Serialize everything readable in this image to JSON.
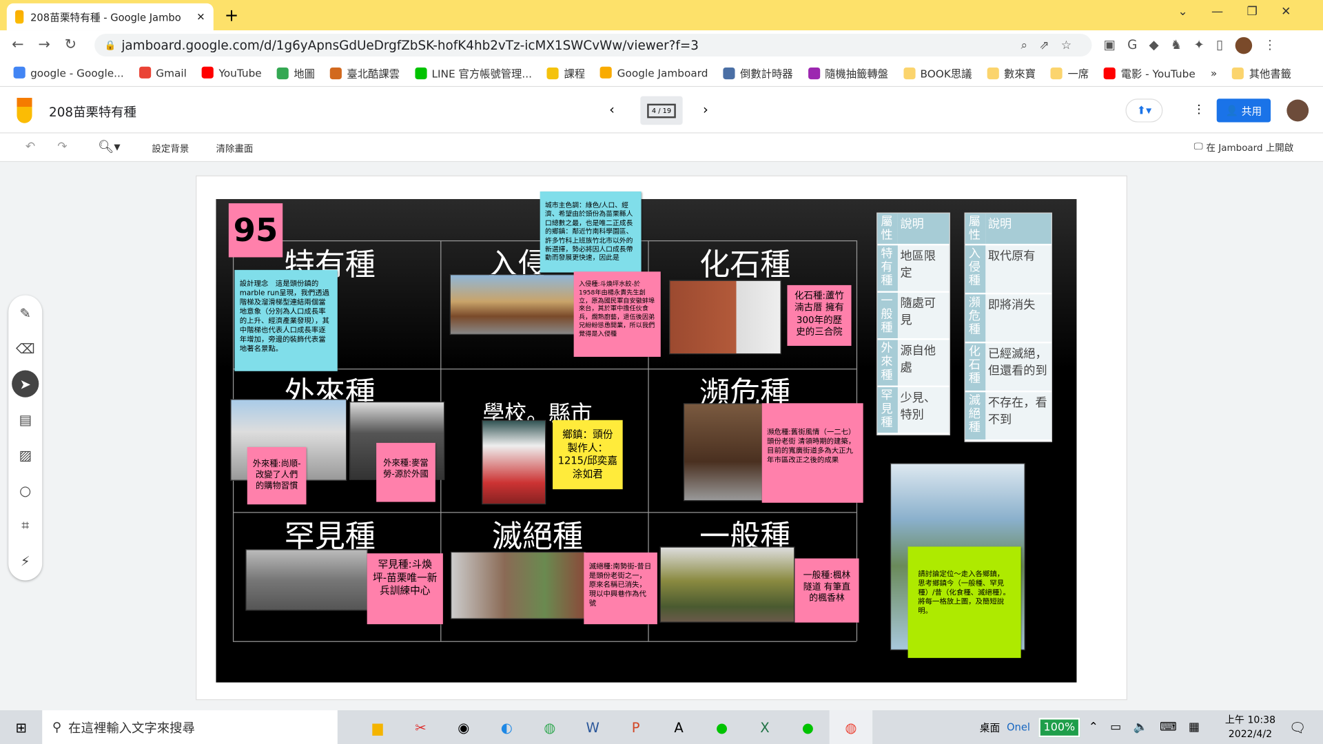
{
  "browser": {
    "tab_title": "208苗栗特有種 - Google Jambo",
    "url": "jamboard.google.com/d/1g6yApnsGdUeDrgfZbSK-hofK4hb2vTz-icMX1SWCvWw/viewer?f=3",
    "bookmarks": [
      {
        "label": "google - Google...",
        "color": "#4285f4"
      },
      {
        "label": "Gmail",
        "color": "#ea4335"
      },
      {
        "label": "YouTube",
        "color": "#ff0000"
      },
      {
        "label": "地圖",
        "color": "#34a853"
      },
      {
        "label": "臺北酷課雲",
        "color": "#d2691e"
      },
      {
        "label": "LINE 官方帳號管理...",
        "color": "#00c300"
      },
      {
        "label": "課程",
        "color": "#f4c20d"
      },
      {
        "label": "Google Jamboard",
        "color": "#f9ab00"
      },
      {
        "label": "倒數計時器",
        "color": "#4a6fa5"
      },
      {
        "label": "隨機抽籤轉盤",
        "color": "#9c27b0"
      },
      {
        "label": "BOOK思議",
        "color": "#fbd46d"
      },
      {
        "label": "數來寶",
        "color": "#fbd46d"
      },
      {
        "label": "一席",
        "color": "#fbd46d"
      },
      {
        "label": "電影 - YouTube",
        "color": "#ff0000"
      }
    ],
    "bookmarks_more": "»",
    "other_bookmarks": "其他書籤"
  },
  "jamboard": {
    "title": "208苗栗特有種",
    "page_indicator": "4 / 19",
    "share_label": "共用",
    "bg_label": "設定背景",
    "clear_label": "清除畫面",
    "open_label": "在 Jamboard 上開啟"
  },
  "slide": {
    "number": "95",
    "categories": {
      "endemic": "特有種",
      "invasive": "入侵",
      "fossil": "化石種",
      "alien": "外來種",
      "school": "學校。縣市",
      "endangered": "瀕危種",
      "rare": "罕見種",
      "extinct": "滅絕種",
      "common": "一般種"
    },
    "notes": {
      "design": "設計理念　這是頭份鎮的marble run呈現，我們透過階梯及溜滑梯型連結兩個當地意象（分別為人口成長率的上升、經濟產業發現），其中階梯也代表人口成長率逐年增加，旁邊的裝飾代表當地著名景點。",
      "city": "城市主色調：綠色/人口、經濟、希望由於頭份為苗栗縣人口總數之最，也是唯二正成長的鄉鎮：鄰近竹南科學園區、許多竹科上班族竹北市以外的新選擇，勢必將因人口成長帶動而發展更快速，因此是",
      "invasive": "入侵種:斗煥坪水餃-於1958年由楊永貴先生創立，原為國民軍自安徽蚌埠來台，其於軍中擔任伙食兵，燗熟廚藝，退伍後因弟兄紛紛慫恿開業，所以我們覺得是入侵種",
      "fossil": "化石種:蘆竹湳古厝 擁有300年的歷史的三合院",
      "alien1": "外來種:尚順-改變了人們的購物習慣",
      "alien2": "外來種:麥當勞-源於外國",
      "town": "鄉鎮：頭份製作人：1215/邱奕嘉涂如君",
      "endangered": "瀕危種:舊街風情（一二七）頭份老街 清領時期的建築，目前的寬廣街道多為大正九年市區改正之後的成果",
      "rare": "罕見種:斗煥坪-苗栗唯一新兵訓練中心",
      "extinct": "滅絕種:南勢街-昔日是頭份老街之一，原來名稱已消失，現以中興巷作為代號",
      "common": "一般種:楓林隧道 有筆直的楓香林",
      "instruction": "請討論定位～走入各鄉鎮，思考鄉鎮今（一般種、罕見種）/昔（化食種、滅絕種）。將每一格放上圖，及簡短說明。"
    },
    "table1": {
      "header": [
        "屬性",
        "說明"
      ],
      "rows": [
        [
          "特有種",
          "地區限定"
        ],
        [
          "一般種",
          "隨處可見"
        ],
        [
          "外來種",
          "源自他處"
        ],
        [
          "罕見種",
          "少見、特別"
        ]
      ]
    },
    "table2": {
      "header": [
        "屬性",
        "說明"
      ],
      "rows": [
        [
          "入侵種",
          "取代原有"
        ],
        [
          "瀕危種",
          "即將消失"
        ],
        [
          "化石種",
          "已經滅絕，但還看的到"
        ],
        [
          "滅絕種",
          "不存在，看不到"
        ]
      ]
    }
  },
  "taskbar": {
    "search_placeholder": "在這裡輸入文字來搜尋",
    "desktop": "桌面",
    "onedrive": "Onel",
    "battery": "100%",
    "time": "上午 10:38",
    "date": "2022/4/2"
  },
  "colors": {
    "tabbar": "#fde16a",
    "note_pink": "#ff80ab",
    "note_cyan": "#80deea",
    "note_yellow": "#ffeb3b",
    "note_lime": "#aeea00",
    "share": "#1a73e8"
  }
}
